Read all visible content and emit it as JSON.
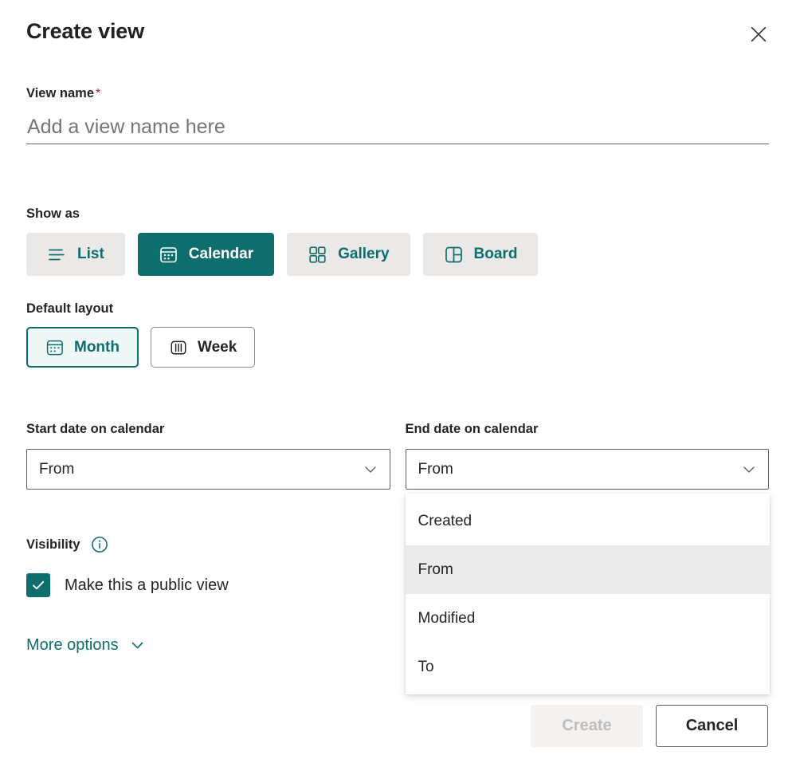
{
  "dialog": {
    "title": "Create view",
    "close_label": "Close"
  },
  "view_name": {
    "label": "View name",
    "required_marker": "*",
    "value": "",
    "placeholder": "Add a view name here"
  },
  "show_as": {
    "label": "Show as",
    "options": [
      {
        "label": "List",
        "icon": "list-icon",
        "selected": false
      },
      {
        "label": "Calendar",
        "icon": "calendar-icon",
        "selected": true
      },
      {
        "label": "Gallery",
        "icon": "gallery-icon",
        "selected": false
      },
      {
        "label": "Board",
        "icon": "board-icon",
        "selected": false
      }
    ]
  },
  "default_layout": {
    "label": "Default layout",
    "options": [
      {
        "label": "Month",
        "icon": "calendar-month-icon",
        "selected": true
      },
      {
        "label": "Week",
        "icon": "calendar-week-icon",
        "selected": false
      }
    ]
  },
  "start_date": {
    "label": "Start date on calendar",
    "value": "From",
    "chevron": "chevron-down-icon"
  },
  "end_date": {
    "label": "End date on calendar",
    "value": "From",
    "chevron": "chevron-down-icon",
    "expanded": true,
    "options": [
      {
        "label": "Created",
        "active": false
      },
      {
        "label": "From",
        "active": true
      },
      {
        "label": "Modified",
        "active": false
      },
      {
        "label": "To",
        "active": false
      }
    ]
  },
  "visibility": {
    "label": "Visibility",
    "info_icon": "info-icon",
    "checkbox_label": "Make this a public view",
    "checked": true
  },
  "more_options": {
    "label": "More options",
    "chevron": "chevron-down-icon"
  },
  "footer": {
    "create_label": "Create",
    "create_disabled": true,
    "cancel_label": "Cancel"
  },
  "colors": {
    "accent_teal": "#0e6e6e",
    "pill_bg": "#ebe9e7",
    "selected_layout_bg": "#f0f7f7",
    "dropdown_active_bg": "#ebebeb",
    "required_red": "#a4262c",
    "text": "#242424",
    "placeholder": "#757575",
    "disabled_text": "#bdbdbd"
  }
}
